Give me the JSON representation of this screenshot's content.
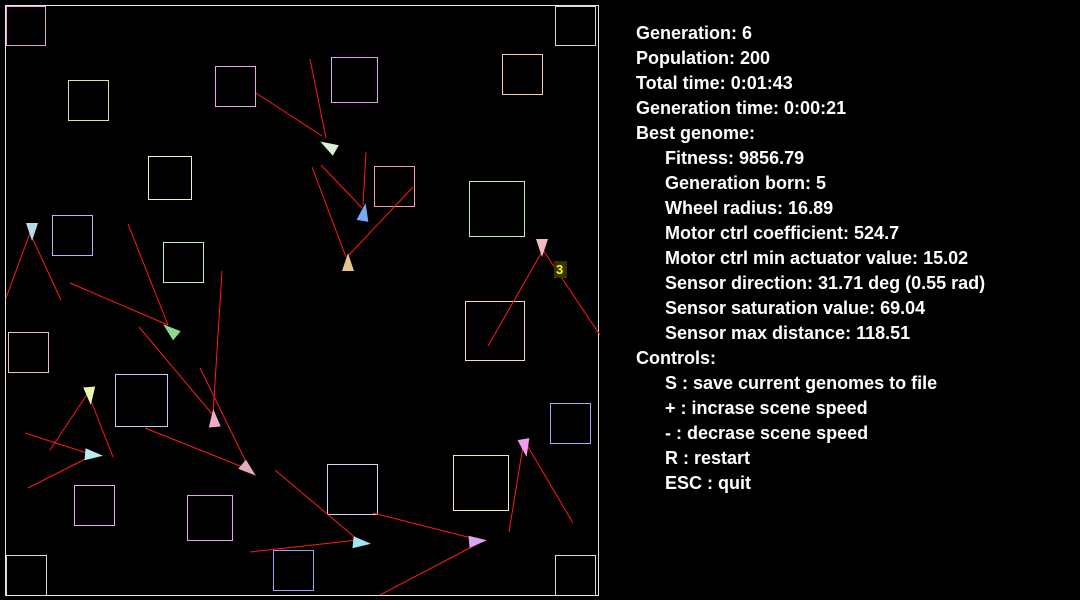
{
  "stats": {
    "generation_label": "Generation:",
    "generation": "6",
    "population_label": "Population:",
    "population": "200",
    "total_time_label": "Total time:",
    "total_time": "0:01:43",
    "generation_time_label": "Generation time:",
    "generation_time": "0:00:21"
  },
  "best_genome": {
    "heading": "Best genome:",
    "fitness_label": "Fitness:",
    "fitness": "9856.79",
    "generation_born_label": "Generation born:",
    "generation_born": "5",
    "wheel_radius_label": "Wheel radius:",
    "wheel_radius": "16.89",
    "motor_coeff_label": "Motor ctrl coefficient:",
    "motor_coeff": "524.7",
    "motor_min_label": "Motor ctrl min actuator value:",
    "motor_min": "15.02",
    "sensor_direction_label": "Sensor direction:",
    "sensor_direction": "31.71 deg (0.55 rad)",
    "sensor_saturation_label": "Sensor saturation value:",
    "sensor_saturation": "69.04",
    "sensor_max_distance_label": "Sensor max distance:",
    "sensor_max_distance": "118.51"
  },
  "controls": {
    "heading": "Controls:",
    "items": [
      "S : save current genomes to file",
      "+ : incrase scene speed",
      "- : decrase scene speed",
      "R : restart",
      "ESC : quit"
    ]
  },
  "scene": {
    "best_agent_label": "3",
    "colors": {
      "background": "#000000",
      "border": "#e6e6e6",
      "sensor_line": "#ff1a1a",
      "label_bg": "#333300",
      "label_fg": "#ffff00"
    }
  }
}
